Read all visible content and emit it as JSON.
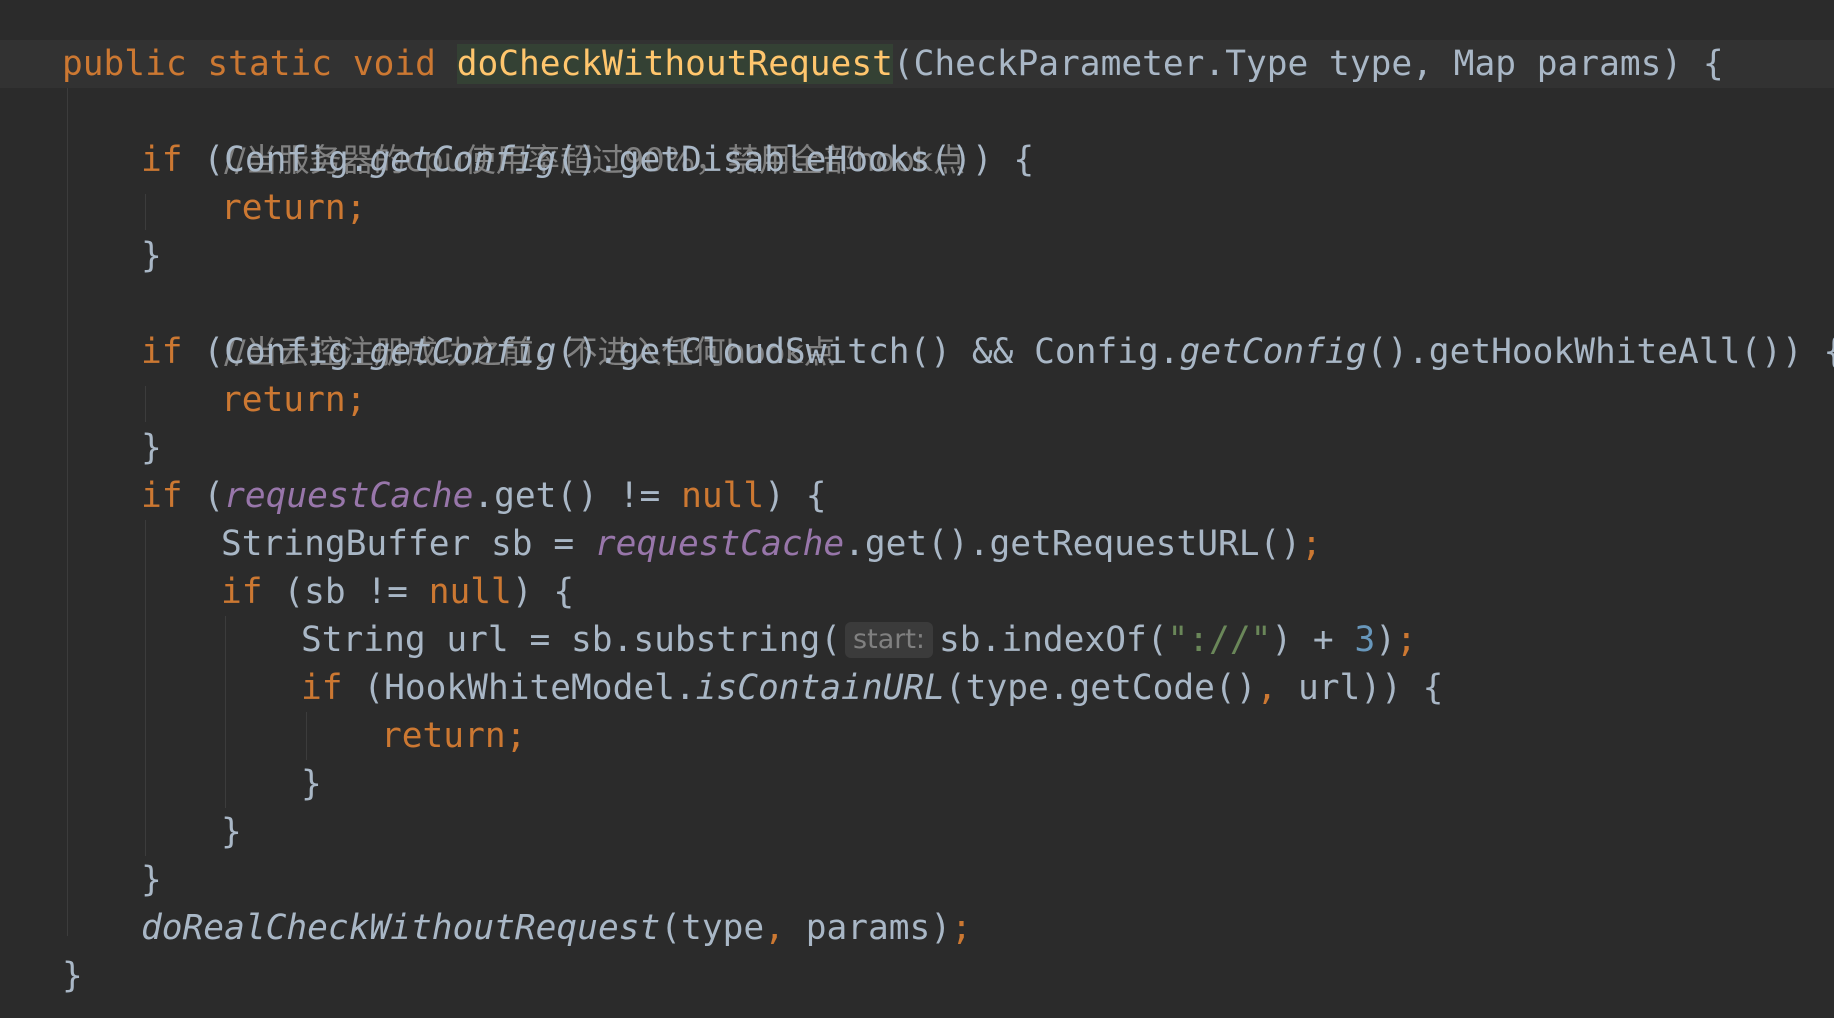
{
  "editor": {
    "language": "java",
    "colors": {
      "background": "#2b2b2b",
      "current_line": "#323232",
      "keyword": "#cc7832",
      "method_declaration": "#ffc66d",
      "field": "#9876aa",
      "comment": "#808080",
      "string": "#6a8759",
      "number": "#6897bb",
      "text": "#a9b7c6"
    },
    "gutter_icon": "intention-bulb-icon",
    "lines": [
      {
        "doc_end": "*/"
      },
      {
        "kw_public": "public",
        "kw_static": "static",
        "kw_void": "void",
        "method_name": "doCheckWithoutRequest",
        "params_text": "(CheckParameter.Type type, Map params) {"
      },
      {
        "comment": "//当服务器的cpu使用率超过90%，禁用全部hook点"
      },
      {
        "kw_if": "if",
        "open": " (Config.",
        "static_call": "getConfig",
        "rest": "().getDisableHooks()) {"
      },
      {
        "kw_return": "return;"
      },
      {
        "brace": "}"
      },
      {
        "comment": "//当云控注册成功之前，不进入任何hook点"
      },
      {
        "kw_if": "if",
        "open": " (Config.",
        "static_call_1": "getConfig",
        "mid": "().getCloudSwitch() && Config.",
        "static_call_2": "getConfig",
        "rest": "().getHookWhiteAll()) {"
      },
      {
        "kw_return": "return;"
      },
      {
        "brace": "}"
      },
      {
        "kw_if": "if",
        "open": " (",
        "field": "requestCache",
        "mid": ".get() != ",
        "kw_null": "null",
        "rest": ") {"
      },
      {
        "decl": "StringBuffer sb = ",
        "field": "requestCache",
        "rest": ".get().getRequestURL()",
        "semi": ";"
      },
      {
        "kw_if": "if",
        "mid": " (sb != ",
        "kw_null": "null",
        "rest": ") {"
      },
      {
        "decl": "String url = sb.substring(",
        "param_hint": "start:",
        "call": "sb.indexOf(",
        "string": "\"://\"",
        "plus": ") + ",
        "number": "3",
        "close": ")",
        "semi": ";"
      },
      {
        "kw_if": "if",
        "open": " (HookWhiteModel.",
        "static_call": "isContainURL",
        "args_a": "(type.getCode()",
        "comma": ",",
        "args_b": " url)) {"
      },
      {
        "kw_return": "return;"
      },
      {
        "brace": "}"
      },
      {
        "brace": "}"
      },
      {
        "brace": "}"
      },
      {
        "static_call": "doRealCheckWithoutRequest",
        "args_a": "(type",
        "comma": ",",
        "args_b": " params)",
        "semi": ";"
      },
      {
        "brace": "}"
      }
    ]
  }
}
